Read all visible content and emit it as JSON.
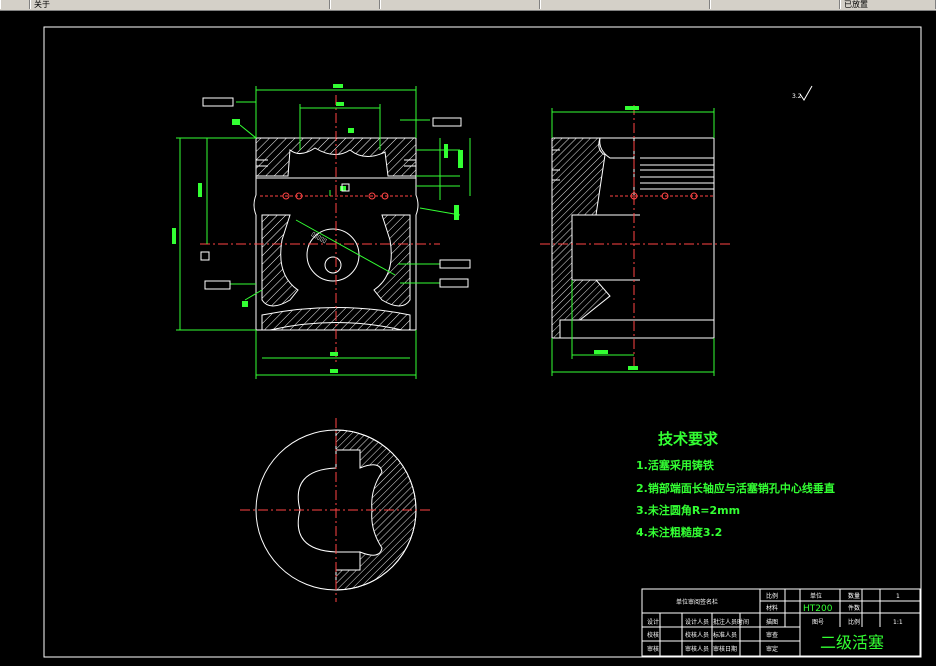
{
  "toolbar": {
    "cells": [
      "关于",
      "",
      "",
      "",
      "",
      "",
      "",
      "",
      "已放置"
    ]
  },
  "drawing": {
    "roughness_note": "3.2",
    "tech_title": "技术要求",
    "tech_items": [
      "1.活塞采用铸铁",
      "2.销部端面长轴应与活塞销孔中心线垂直",
      "3.未注圆角R=2mm",
      "4.未注粗糙度3.2"
    ]
  },
  "title_block": {
    "school": "单位审阅签名栏",
    "labels": {
      "r1c4": "比例",
      "r1c5": "单位",
      "r1c6": "数量",
      "r1c7": "1",
      "material_label": "材料",
      "material": "HT200",
      "mass_label": "件数",
      "r3_designer": "设计",
      "r3_person": "设计人员",
      "r3_date": "批注人员时间",
      "r3_cat": "描图",
      "r3_no": "图号",
      "r3_scale_label": "比例",
      "r3_scale": "1:1",
      "r4_a": "校核",
      "r4_b": "校核人员",
      "r4_c": "标准人员",
      "r4_d": "审查",
      "r5_a": "审核",
      "r5_b": "审核人员",
      "r5_c": "审核日期",
      "r5_d": "审定"
    },
    "part_name": "二级活塞"
  }
}
